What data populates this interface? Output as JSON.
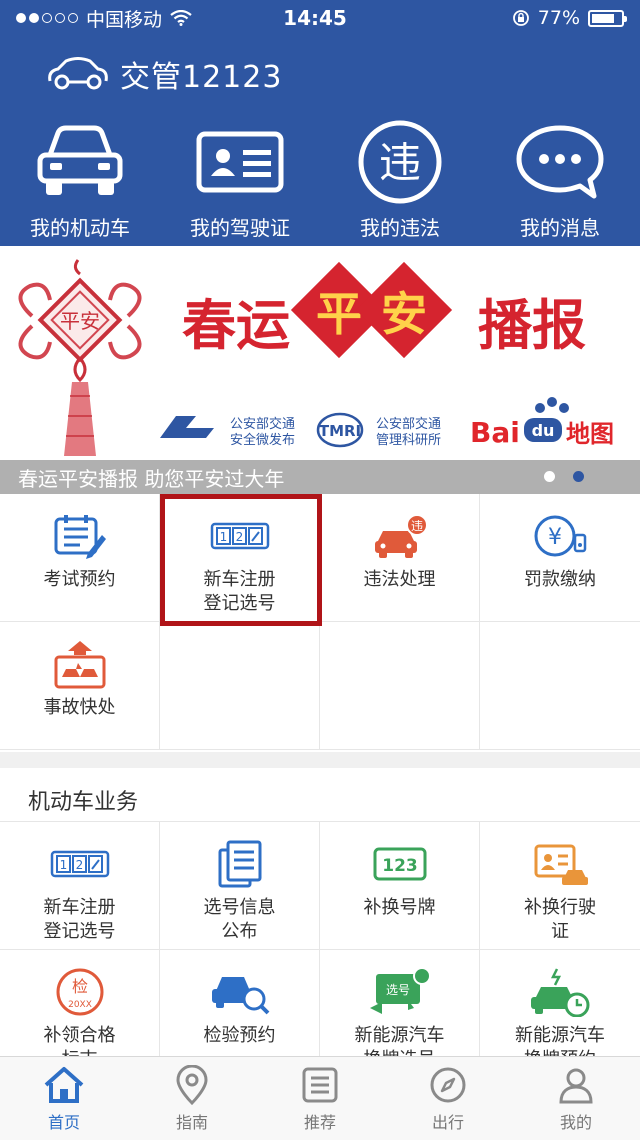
{
  "status_bar": {
    "carrier": "中国移动",
    "time": "14:45",
    "battery": "77%",
    "battery_level": 0.77
  },
  "header": {
    "title": "交管12123",
    "quick_links": [
      {
        "label": "我的机动车",
        "icon": "car-icon"
      },
      {
        "label": "我的驾驶证",
        "icon": "license-card-icon"
      },
      {
        "label": "我的违法",
        "icon": "violation-icon",
        "icon_text": "违"
      },
      {
        "label": "我的消息",
        "icon": "message-bubble-icon"
      }
    ]
  },
  "banner": {
    "headline": "春运平安播报",
    "partners": [
      "公安部交通安全微发布",
      "公安部交通管理科研所",
      "Baidu地图"
    ],
    "caption": "春运平安播报 助您平安过大年",
    "page_count": 2,
    "active_page": 2
  },
  "services": {
    "items": [
      {
        "label": "考试预约",
        "icon": "exam-booking-icon"
      },
      {
        "label": "新车注册\n登记选号",
        "icon": "plate-number-icon"
      },
      {
        "label": "违法处理",
        "icon": "violation-car-icon"
      },
      {
        "label": "罚款缴纳",
        "icon": "fine-payment-icon"
      },
      {
        "label": "事故快处",
        "icon": "accident-icon"
      }
    ],
    "highlighted_index": 1
  },
  "vehicle_section": {
    "title": "机动车业务",
    "items": [
      {
        "label": "新车注册\n登记选号",
        "icon": "plate-number-icon"
      },
      {
        "label": "选号信息\n公布",
        "icon": "document-icon"
      },
      {
        "label": "补换号牌",
        "icon": "plate-123-icon",
        "icon_text": "123"
      },
      {
        "label": "补换行驶\n证",
        "icon": "driving-permit-icon"
      },
      {
        "label": "补领合格\n标志",
        "icon": "inspection-badge-icon",
        "icon_text": "检",
        "icon_subtext": "20XX"
      },
      {
        "label": "检验预约",
        "icon": "car-search-icon"
      },
      {
        "label": "新能源汽车\n换牌选号",
        "icon": "new-energy-plate-icon",
        "icon_text": "选号"
      },
      {
        "label": "新能源汽车\n换牌预约",
        "icon": "new-energy-booking-icon"
      }
    ]
  },
  "tab_bar": {
    "tabs": [
      {
        "label": "首页",
        "icon": "home-icon",
        "active": true
      },
      {
        "label": "指南",
        "icon": "location-pin-icon"
      },
      {
        "label": "推荐",
        "icon": "list-icon"
      },
      {
        "label": "出行",
        "icon": "compass-icon"
      },
      {
        "label": "我的",
        "icon": "user-icon"
      }
    ]
  },
  "colors": {
    "primary": "#2e56a2",
    "accent_blue": "#2e6fc6",
    "accent_red": "#e05a3a",
    "highlight": "#b01418",
    "green": "#3aa35a",
    "orange": "#e9953a"
  }
}
